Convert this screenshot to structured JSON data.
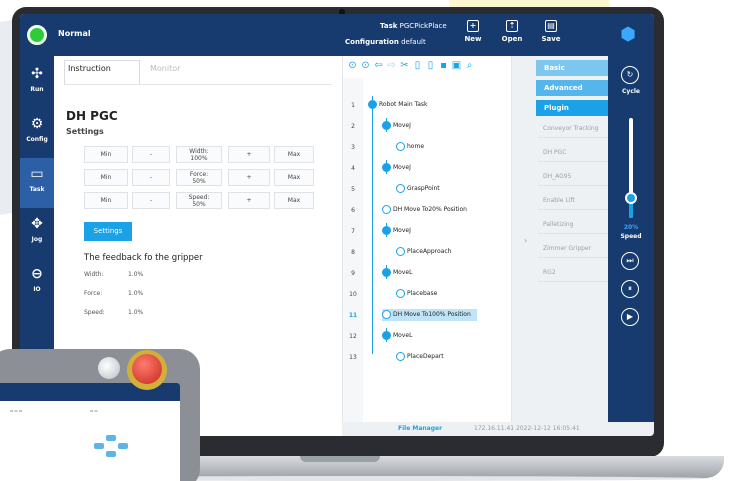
{
  "topbar": {
    "mode": "Normal",
    "task_key": "Task",
    "task_value": "PGCPickPlace",
    "config_key": "Configuration",
    "config_value": "default",
    "new_label": "New",
    "open_label": "Open",
    "save_label": "Save"
  },
  "nav": {
    "run": "Run",
    "config": "Config",
    "task": "Task",
    "jog": "Jog",
    "io": "IO"
  },
  "panel": {
    "tab_instruction": "Instruction",
    "tab_monitor": "Monitor",
    "title": "DH PGC",
    "settings_label": "Settings",
    "rows": [
      {
        "min": "Min",
        "minus": "-",
        "value_label": "Width:",
        "value": "100%",
        "plus": "+",
        "max": "Max"
      },
      {
        "min": "Min",
        "minus": "-",
        "value_label": "Force:",
        "value": "50%",
        "plus": "+",
        "max": "Max"
      },
      {
        "min": "Min",
        "minus": "-",
        "value_label": "Speed:",
        "value": "50%",
        "plus": "+",
        "max": "Max"
      }
    ],
    "settings_button": "Settings",
    "feedback_title": "The feedback fo the gripper",
    "feedback": [
      {
        "label": "Width:",
        "value": "1.0%"
      },
      {
        "label": "Force:",
        "value": "1.0%"
      },
      {
        "label": "Speed:",
        "value": "1.0%"
      }
    ]
  },
  "tree": {
    "nodes": [
      {
        "num": "1",
        "label": "Robot Main Task"
      },
      {
        "num": "2",
        "label": "MoveJ"
      },
      {
        "num": "3",
        "label": "home"
      },
      {
        "num": "4",
        "label": "MoveJ"
      },
      {
        "num": "5",
        "label": "GraspPoint"
      },
      {
        "num": "6",
        "label": "DH Move To20% Position"
      },
      {
        "num": "7",
        "label": "MoveJ"
      },
      {
        "num": "8",
        "label": "PlaceApproach"
      },
      {
        "num": "9",
        "label": "MoveL"
      },
      {
        "num": "10",
        "label": "Placebase"
      },
      {
        "num": "11",
        "label": "DH Move To100% Position"
      },
      {
        "num": "12",
        "label": "MoveL"
      },
      {
        "num": "13",
        "label": "PlaceDepart"
      }
    ]
  },
  "palette": {
    "basic": "Basic",
    "advanced": "Advanced",
    "plugin": "Plugin",
    "items": [
      "Conveyor Tracking",
      "DH PGC",
      "DH_AG95",
      "Enable Lift",
      "Palletizing",
      "Zimmer Gripper",
      "RG2"
    ]
  },
  "speedcol": {
    "cycle": "Cycle",
    "speed_pct": "20%",
    "speed": "Speed",
    "speed_level": 0.2
  },
  "status": {
    "file_manager": "File Manager",
    "ip": "172.16.11.41 2022-12-12 16:05:41"
  },
  "colors": {
    "nav_bg": "#173a6f",
    "accent": "#1aa1e6",
    "status_ok": "#2ecc3a",
    "estop": "#c5281e"
  }
}
